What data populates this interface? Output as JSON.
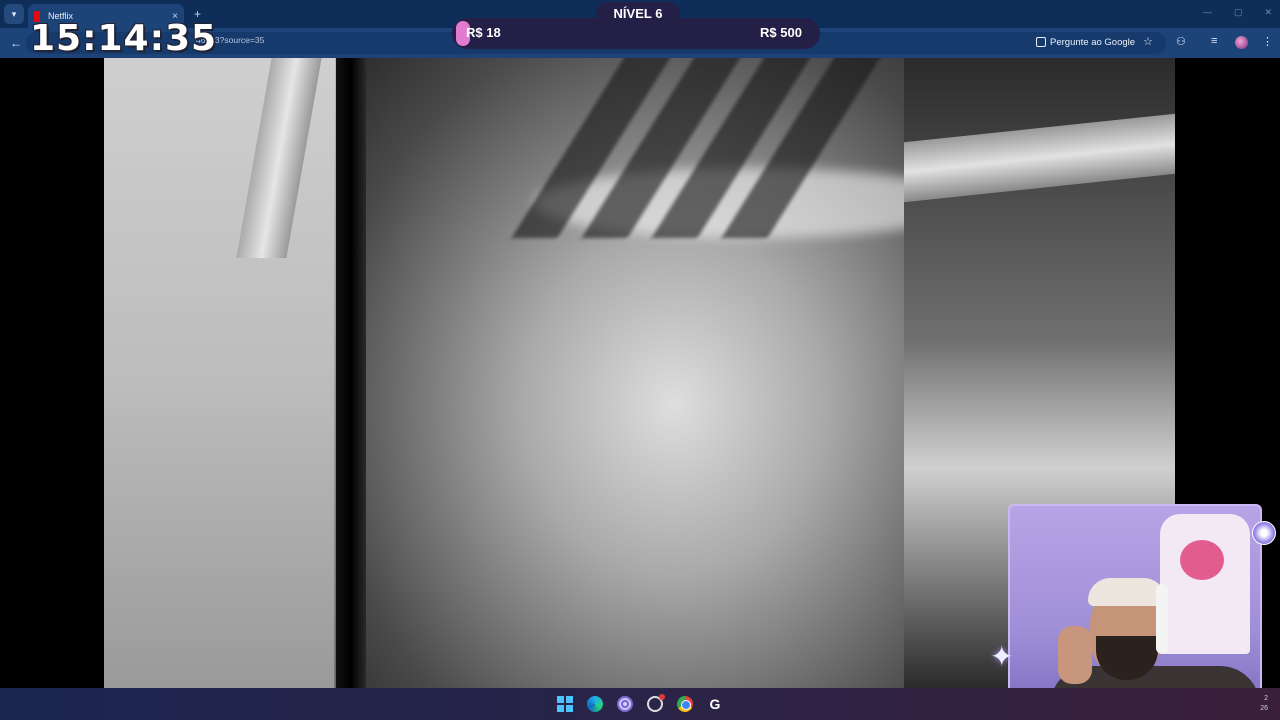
{
  "browser": {
    "tab_title": "Netflix",
    "tab_close": "×",
    "new_tab": "+",
    "url_fragment": "46693?source=35",
    "google_pill_label": "Pergunte ao Google",
    "back_icon": "←",
    "star_icon": "☆",
    "extensions_icon": "⚇",
    "media_icon": "≡",
    "menu_icon": "⋮",
    "window_controls": [
      "—",
      "▢",
      "✕"
    ]
  },
  "overlay": {
    "clock": "15:14:35",
    "level_label": "NÍVEL 6",
    "money_current": "R$ 18",
    "money_goal": "R$ 500",
    "progress_fraction": 0.036
  },
  "taskbar": {
    "apps": [
      "windows-start",
      "edge",
      "spiral-app",
      "obs",
      "chrome",
      "logitech-g"
    ],
    "tray_line1": "2",
    "tray_line2": "26"
  },
  "colors": {
    "tab_strip": "#0f2d59",
    "toolbar": "#1c4479",
    "level_bar": "#241f47",
    "level_fill": "#e07bd0",
    "webcam_border": "#cbb8f2"
  }
}
